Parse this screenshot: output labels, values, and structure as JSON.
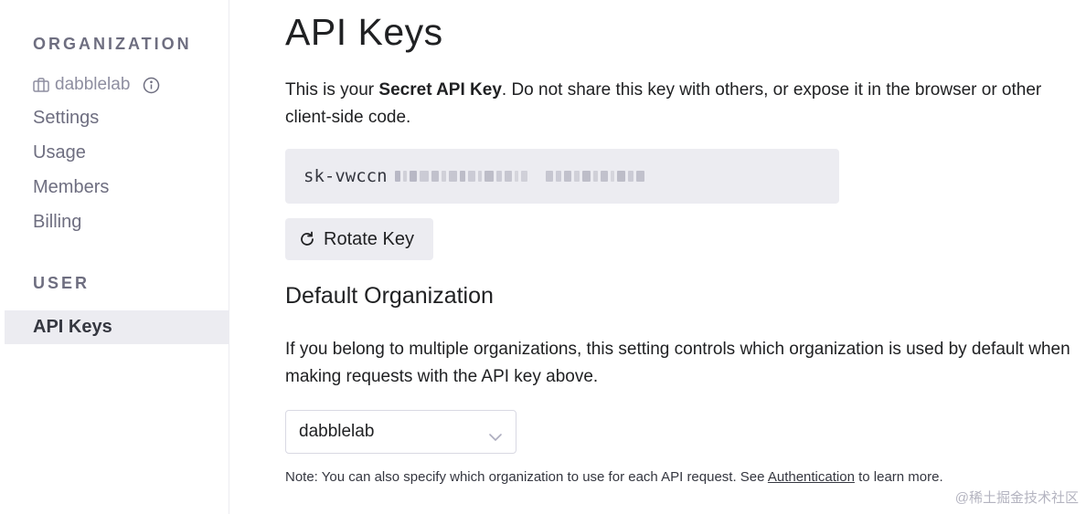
{
  "sidebar": {
    "organization_label": "ORGANIZATION",
    "org_name": "dabblelab",
    "items": [
      {
        "label": "Settings"
      },
      {
        "label": "Usage"
      },
      {
        "label": "Members"
      },
      {
        "label": "Billing"
      }
    ],
    "user_label": "USER",
    "active_item": "API Keys"
  },
  "main": {
    "title": "API Keys",
    "intro_before": "This is your ",
    "intro_bold": "Secret API Key",
    "intro_after": ". Do not share this key with others, or expose it in the browser or other client-side code.",
    "key_prefix": "sk-vwccn",
    "rotate_label": "Rotate Key",
    "default_org_title": "Default Organization",
    "default_org_desc": "If you belong to multiple organizations, this setting controls which organization is used by default when making requests with the API key above.",
    "selected_org": "dabblelab",
    "note_before": "Note: You can also specify which organization to use for each API request. See ",
    "note_link": "Authentication",
    "note_after": " to learn more."
  },
  "watermark": "@稀土掘金技术社区",
  "icons": {
    "org": "briefcase-icon",
    "info": "info-icon",
    "rotate": "refresh-icon",
    "select": "chevron-down-icon"
  },
  "colors": {
    "sidebar_active_bg": "#ececf1",
    "text_primary": "#202123",
    "text_muted": "#6e6e80"
  }
}
